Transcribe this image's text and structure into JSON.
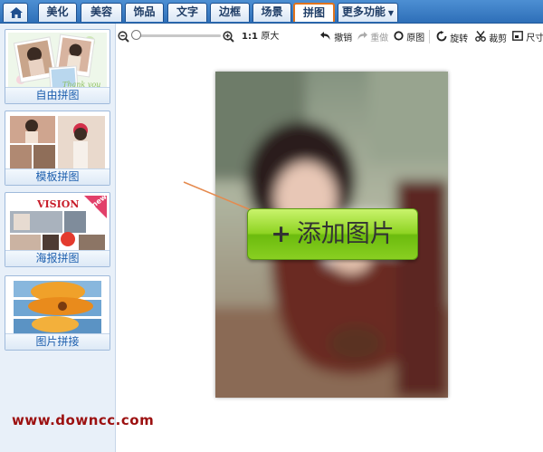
{
  "tabs": [
    {
      "id": "home",
      "label": ""
    },
    {
      "id": "beautify",
      "label": "美化"
    },
    {
      "id": "beauty",
      "label": "美容"
    },
    {
      "id": "decor",
      "label": "饰品"
    },
    {
      "id": "text",
      "label": "文字"
    },
    {
      "id": "frame",
      "label": "边框"
    },
    {
      "id": "scene",
      "label": "场景"
    },
    {
      "id": "collage",
      "label": "拼图",
      "active": true
    },
    {
      "id": "more",
      "label": "更多功能"
    }
  ],
  "sidebar": {
    "items": [
      {
        "label": "自由拼图"
      },
      {
        "label": "模板拼图"
      },
      {
        "label": "海报拼图",
        "badge": "new",
        "thumb_text": "VISION"
      },
      {
        "label": "图片拼接"
      }
    ]
  },
  "toolbar": {
    "zoom_ratio": "1:1",
    "actual_size": "原大",
    "undo": "撤销",
    "redo": "重做",
    "original": "原图",
    "rotate": "旋转",
    "crop": "裁剪",
    "size": "尺寸"
  },
  "canvas": {
    "add_button_label": "添加图片"
  },
  "watermark": "www.downcc.com",
  "colors": {
    "tab_bar": "#2e6fb8",
    "active_tab_border": "#e2741c",
    "add_button": "#8fd423",
    "watermark": "#9c1010",
    "arrow": "#e58a4e"
  }
}
